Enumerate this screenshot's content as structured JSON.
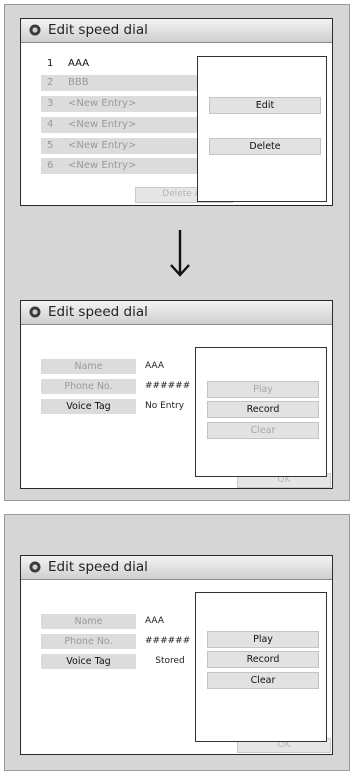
{
  "screen_title": "Edit speed dial",
  "panel1": {
    "entries": [
      {
        "num": "1",
        "label": "AAA"
      },
      {
        "num": "2",
        "label": "BBB"
      },
      {
        "num": "3",
        "label": "<New Entry>"
      },
      {
        "num": "4",
        "label": "<New Entry>"
      },
      {
        "num": "5",
        "label": "<New Entry>"
      },
      {
        "num": "6",
        "label": "<New Entry>"
      }
    ],
    "menu": {
      "edit": "Edit",
      "delete": "Delete"
    },
    "delete_all": "Delete All"
  },
  "panel2": {
    "fields": {
      "name_label": "Name",
      "name_value": "AAA",
      "phone_label": "Phone No.",
      "phone_value": "######",
      "voice_label": "Voice Tag",
      "voice_value": "No Entry"
    },
    "menu": {
      "play": "Play",
      "record": "Record",
      "clear": "Clear"
    },
    "ok": "OK"
  },
  "panel3": {
    "fields": {
      "name_label": "Name",
      "name_value": "AAA",
      "phone_label": "Phone No.",
      "phone_value": "######",
      "voice_label": "Voice Tag",
      "voice_value": "Stored"
    },
    "menu": {
      "play": "Play",
      "record": "Record",
      "clear": "Clear"
    },
    "ok": "OK"
  },
  "icons": {
    "title_icon": "gear-icon",
    "transition": "down-arrow-icon"
  },
  "colors": {
    "panel_bg": "#d6d6d6",
    "screen_border": "#2a2a2a",
    "row_bg": "#dcdcdc",
    "disabled_text": "#9a9a9a"
  }
}
